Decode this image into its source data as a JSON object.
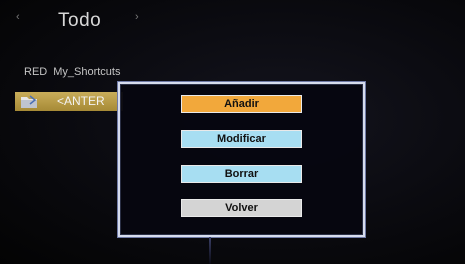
{
  "topbar": {
    "active_tab": "Todo",
    "left_arrow": "‹",
    "right_arrow": "›",
    "hidden_tabs": [
      "",
      "",
      ""
    ]
  },
  "breadcrumb": {
    "source": "RED",
    "folder": "My_Shortcuts"
  },
  "list": {
    "items": [
      {
        "label": "<ANTER",
        "icon": "folder-icon",
        "selected": true
      }
    ]
  },
  "dialog": {
    "buttons": [
      {
        "label": "Añadir",
        "color": "#f2a83b",
        "focused": true
      },
      {
        "label": "Modificar",
        "color": "#a7def2"
      },
      {
        "label": "Borrar",
        "color": "#a7def2"
      },
      {
        "label": "Volver",
        "color": "#d4d4d4"
      }
    ]
  },
  "colors": {
    "accent_orange": "#f2a83b",
    "button_blue": "#a7def2",
    "button_grey": "#d4d4d4",
    "selection_gold": "#b89b46",
    "dialog_border": "#d6dced"
  }
}
